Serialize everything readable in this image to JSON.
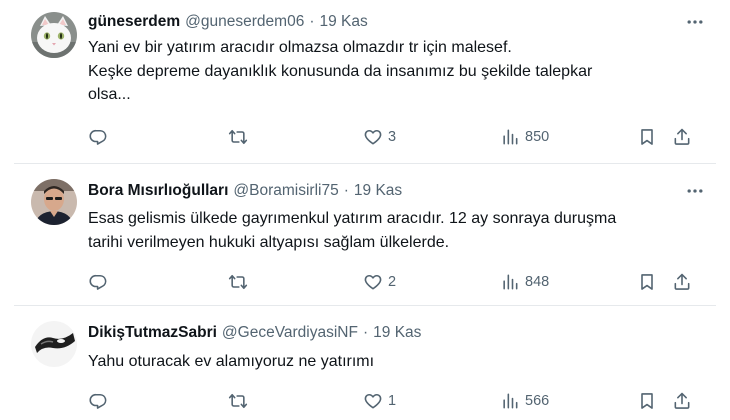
{
  "tweets": [
    {
      "name": "güneserdem",
      "handle": "@guneserdem06",
      "separator": "·",
      "date": "19 Kas",
      "text_lines": [
        "Yani ev bir yatırım aracıdır olmazsa olmazdır tr için malesef.",
        "Keşke depreme dayanıklık konusunda da insanımız bu şekilde talepkar",
        "olsa..."
      ],
      "replies": "",
      "retweets": "",
      "likes": "3",
      "views": "850"
    },
    {
      "name": "Bora Mısırlıoğulları",
      "handle": "@Boramisirli75",
      "separator": "·",
      "date": "19 Kas",
      "text_lines": [
        "Esas gelismis ülkede gayrımenkul yatırım aracıdır. 12 ay sonraya duruşma",
        "tarihi verilmeyen hukuki altyapısı sağlam ülkelerde."
      ],
      "replies": "",
      "retweets": "",
      "likes": "2",
      "views": "848"
    },
    {
      "name": "DikişTutmazSabri",
      "handle": "@GeceVardiyasiNF",
      "separator": "·",
      "date": "19 Kas",
      "text_lines": [
        "Yahu oturacak ev alamıyoruz ne yatırımı"
      ],
      "replies": "",
      "retweets": "",
      "likes": "1",
      "views": "566"
    }
  ],
  "icons": {
    "more": "more-horizontal-icon",
    "reply": "reply-icon",
    "retweet": "retweet-icon",
    "like": "heart-icon",
    "views": "analytics-icon",
    "bookmark": "bookmark-icon",
    "share": "share-icon"
  },
  "colors": {
    "text": "#0f1419",
    "secondary": "#536471",
    "divider": "#e6e9ec",
    "background": "#ffffff"
  }
}
